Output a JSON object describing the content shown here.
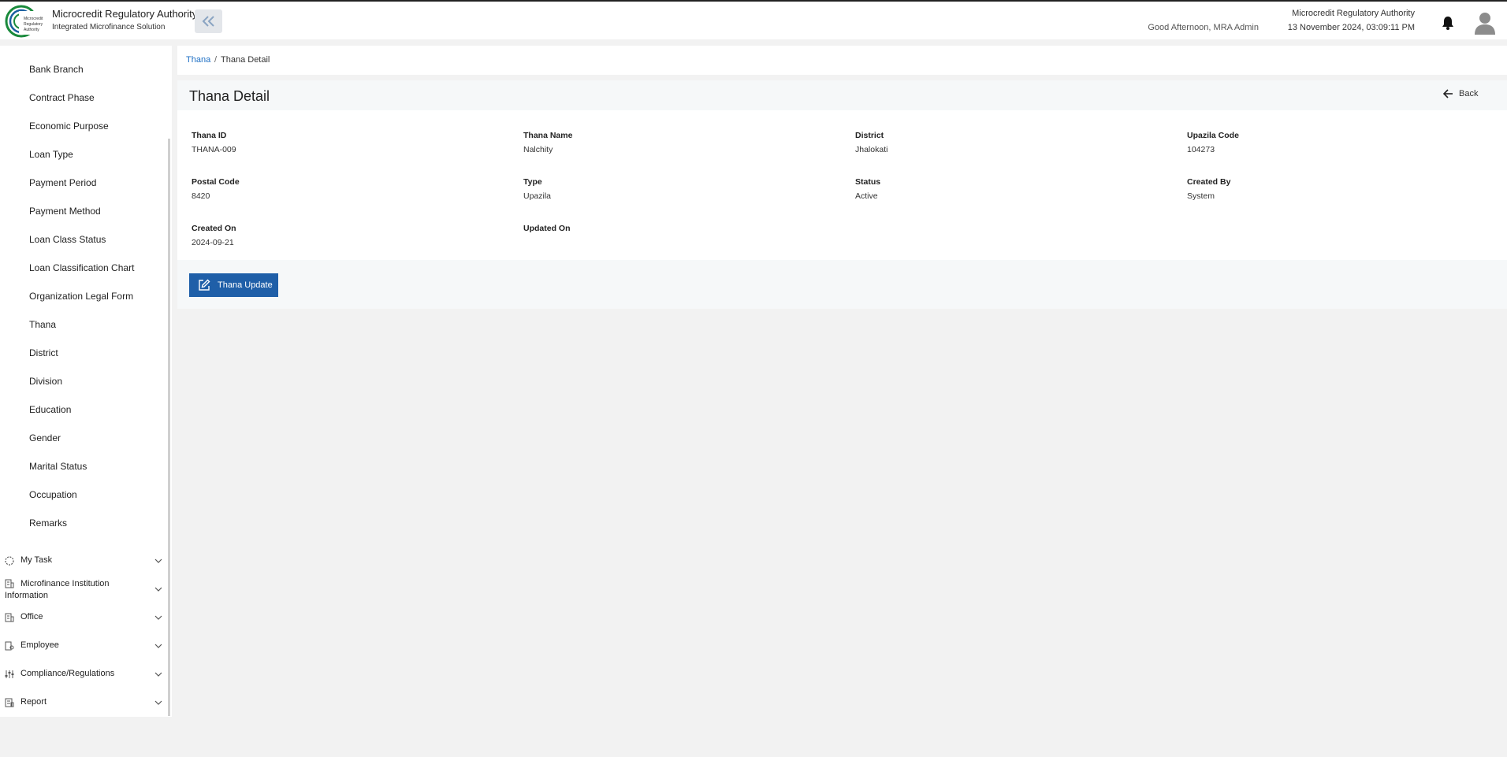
{
  "header": {
    "brand_title": "Microcredit Regulatory Authority",
    "brand_subtitle": "Integrated Microfinance Solution",
    "logo_text": "Microcredit Regulatory Authority",
    "greeting": "Good Afternoon, MRA Admin",
    "org_name": "Microcredit Regulatory Authority",
    "datetime": "13 November 2024, 03:09:11 PM",
    "collapse_icon": "double-chevron-left-icon",
    "bell_icon": "bell-icon",
    "avatar_icon": "user-avatar-icon"
  },
  "sidebar": {
    "sub_items": [
      "Bank Branch",
      "Contract Phase",
      "Economic Purpose",
      "Loan Type",
      "Payment Period",
      "Payment Method",
      "Loan Class Status",
      "Loan Classification Chart",
      "Organization Legal Form",
      "Thana",
      "District",
      "Division",
      "Education",
      "Gender",
      "Marital Status",
      "Occupation",
      "Remarks"
    ],
    "groups": [
      {
        "label": "My Task",
        "icon": "spinner-icon"
      },
      {
        "label": "Microfinance Institution Information",
        "icon": "building-icon"
      },
      {
        "label": "Office",
        "icon": "office-icon"
      },
      {
        "label": "Employee",
        "icon": "employee-icon"
      },
      {
        "label": "Compliance/Regulations",
        "icon": "sliders-icon"
      },
      {
        "label": "Report",
        "icon": "report-icon"
      }
    ]
  },
  "breadcrumb": {
    "parent": "Thana",
    "separator": "/",
    "current": "Thana Detail"
  },
  "detail": {
    "title": "Thana Detail",
    "back_label": "Back",
    "fields": [
      {
        "label": "Thana ID",
        "value": "THANA-009"
      },
      {
        "label": "Thana Name",
        "value": "Nalchity"
      },
      {
        "label": "District",
        "value": "Jhalokati"
      },
      {
        "label": "Upazila Code",
        "value": "104273"
      },
      {
        "label": "Postal Code",
        "value": "8420"
      },
      {
        "label": "Type",
        "value": "Upazila"
      },
      {
        "label": "Status",
        "value": "Active"
      },
      {
        "label": "Created By",
        "value": "System"
      },
      {
        "label": "Created On",
        "value": "2024-09-21"
      },
      {
        "label": "Updated On",
        "value": ""
      }
    ],
    "update_button": "Thana Update"
  },
  "colors": {
    "primary": "#1f5fa8",
    "link": "#1e6fc4",
    "logo_green": "#1a8a3c"
  }
}
